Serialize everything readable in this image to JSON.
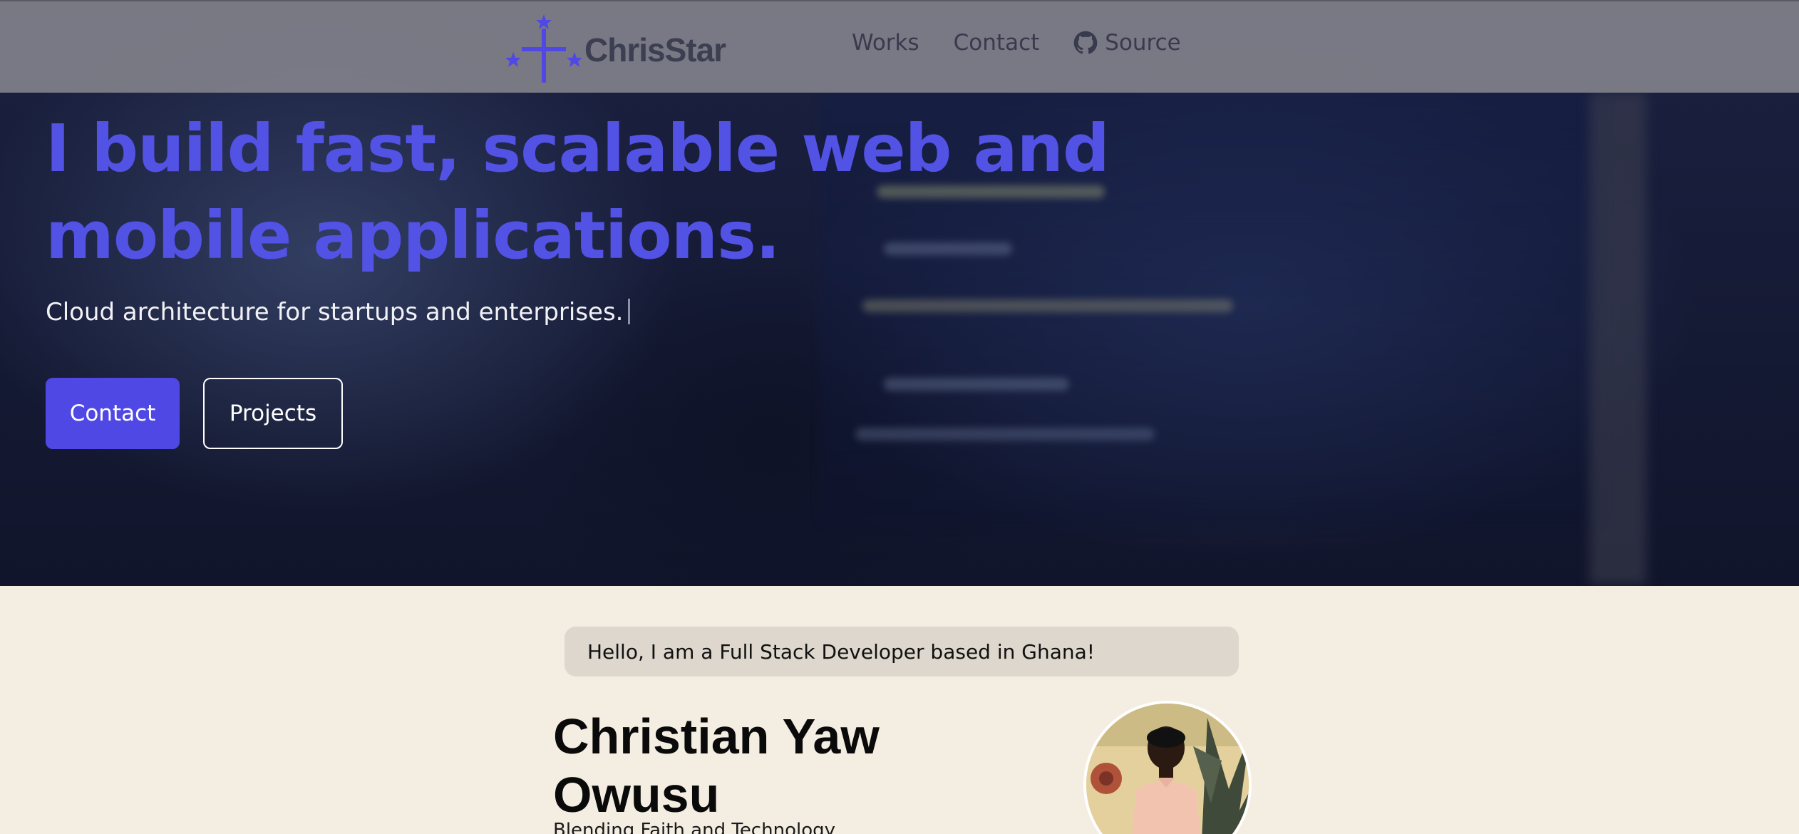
{
  "brand": {
    "name": "ChrisStar",
    "logo_icon": "cross-stars-icon",
    "accent": "#5048e5"
  },
  "nav": {
    "items": [
      {
        "label": "Works"
      },
      {
        "label": "Contact"
      },
      {
        "label": "Source",
        "icon": "github-icon"
      }
    ]
  },
  "hero": {
    "headline_line1": "I build fast, scalable web and",
    "headline_line2": "mobile applications.",
    "subtitle": "Cloud architecture for startups and enterprises.",
    "primary_button": "Contact",
    "secondary_button": "Projects"
  },
  "about": {
    "greeting": "Hello, I am a Full Stack Developer based in Ghana!",
    "name_line1": "Christian Yaw",
    "name_line2": "Owusu",
    "tagline": "Blending Faith and Technology"
  },
  "colors": {
    "hero_headline": "#5252e5",
    "page_background": "#f4ede2",
    "greeting_background": "#ded7cd"
  }
}
